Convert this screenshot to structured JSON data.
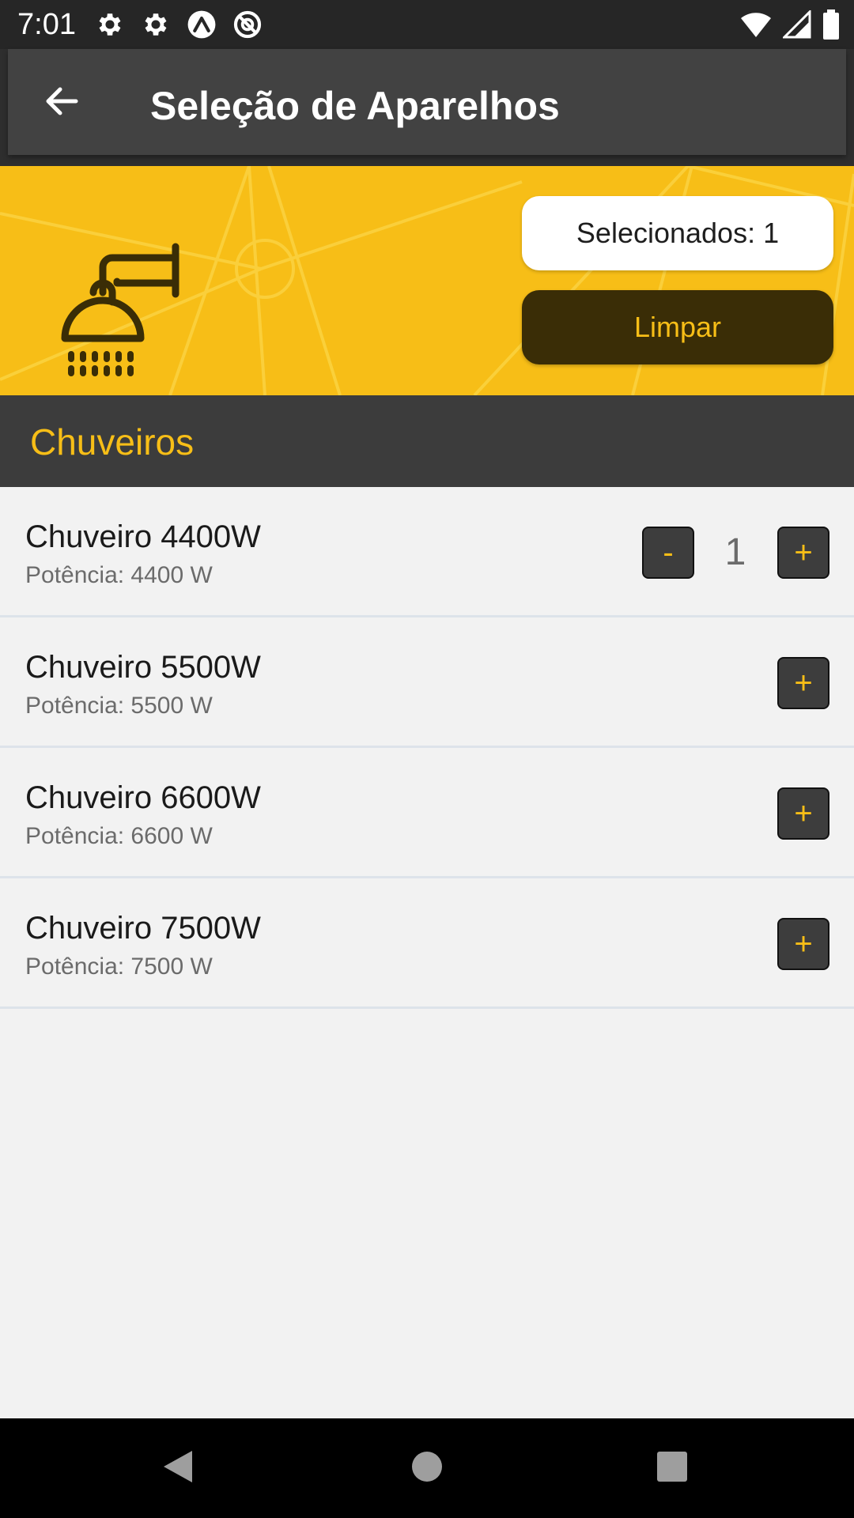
{
  "status_bar": {
    "time": "7:01",
    "icons_left": [
      "gear-icon",
      "gear-icon",
      "expo-icon",
      "no-disturb-icon"
    ],
    "icons_right": [
      "wifi-icon",
      "signal-icon",
      "battery-icon"
    ]
  },
  "app_bar": {
    "title": "Seleção de Aparelhos",
    "back_icon": "arrow-left-icon"
  },
  "banner": {
    "icon": "shower-icon",
    "selected_label": "Selecionados: 1",
    "clear_label": "Limpar",
    "accent_color": "#f7be17"
  },
  "section": {
    "title": "Chuveiros"
  },
  "items": [
    {
      "name": "Chuveiro 4400W",
      "power": "Potência: 4400 W",
      "quantity": "1",
      "minus_label": "-",
      "plus_label": "+"
    },
    {
      "name": "Chuveiro 5500W",
      "power": "Potência: 5500 W",
      "plus_label": "+"
    },
    {
      "name": "Chuveiro 6600W",
      "power": "Potência: 6600 W",
      "plus_label": "+"
    },
    {
      "name": "Chuveiro 7500W",
      "power": "Potência: 7500 W",
      "plus_label": "+"
    }
  ],
  "nav_bar": {
    "buttons": [
      "back-triangle-icon",
      "home-circle-icon",
      "recents-square-icon"
    ]
  }
}
